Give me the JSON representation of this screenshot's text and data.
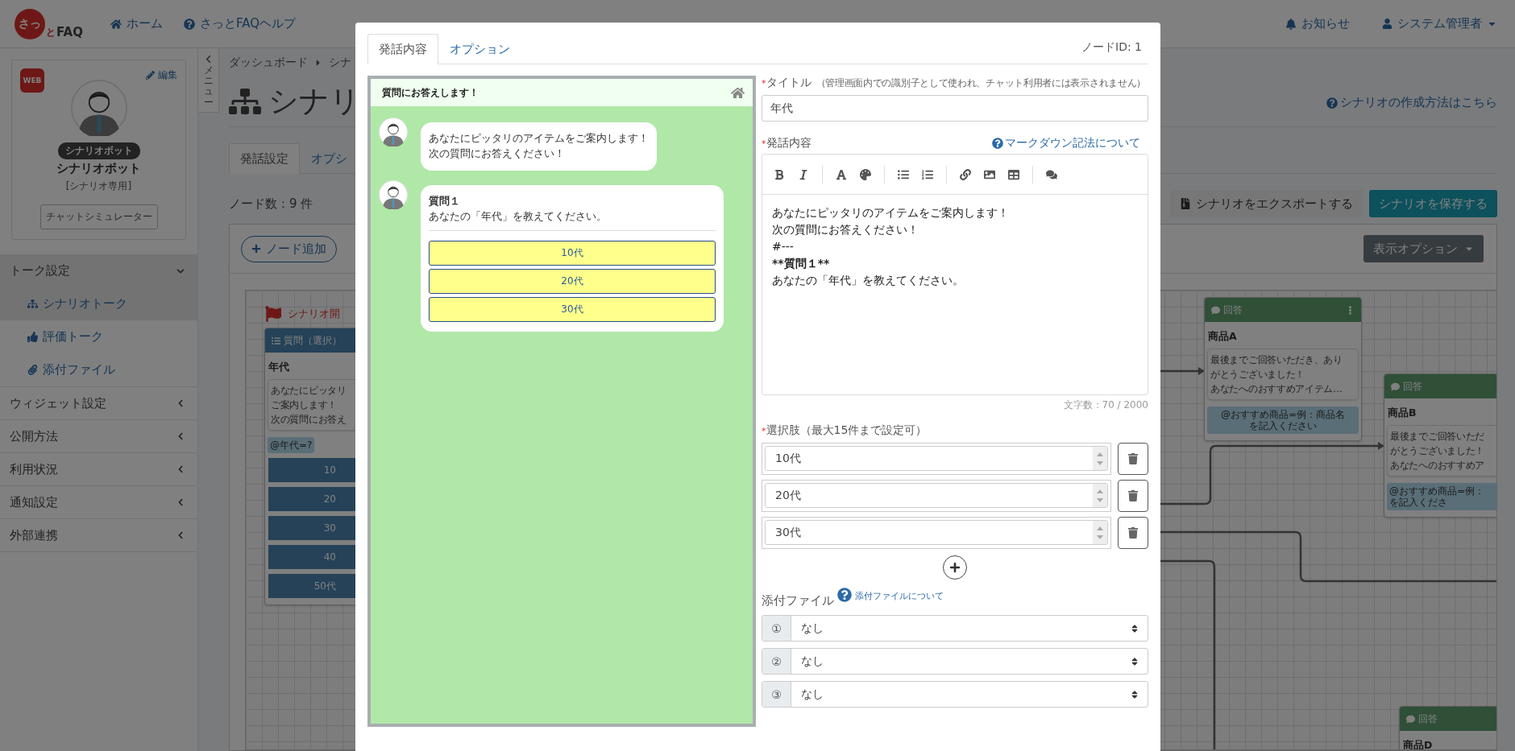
{
  "header": {
    "logo": {
      "mark": "さっ",
      "tail": "と",
      "name": "FAQ"
    },
    "nav": [
      {
        "label": "ホーム",
        "kind": "home"
      },
      {
        "label": "さっとFAQヘルプ",
        "kind": "help"
      }
    ],
    "notifications": "お知らせ",
    "user": "システム管理者"
  },
  "profile": {
    "badge": "WEB",
    "edit": "編集",
    "tag": "シナリオボット",
    "name": "シナリオボット",
    "note": "[シナリオ専用]",
    "simulator_button": "チャットシミュレーター"
  },
  "sidebar": {
    "items": [
      {
        "label": "トーク設定",
        "expanded": true,
        "children": [
          {
            "label": "シナリオトーク",
            "kind": "scenario",
            "selected": true
          },
          {
            "label": "評価トーク",
            "kind": "rating",
            "selected": false
          },
          {
            "label": "添付ファイル",
            "kind": "attachment",
            "selected": false
          }
        ]
      },
      {
        "label": "ウィジェット設定",
        "expanded": false
      },
      {
        "label": "公開方法",
        "expanded": false
      },
      {
        "label": "利用状況",
        "expanded": false
      },
      {
        "label": "通知設定",
        "expanded": false
      },
      {
        "label": "外部連携",
        "expanded": false
      }
    ]
  },
  "menu_toggle": "メニュー",
  "breadcrumb": [
    "ダッシュボード",
    "シナ"
  ],
  "page_title": "シナリ",
  "help_link": "シナリオの作成方法はこちら",
  "tabs": [
    {
      "label": "発話設定",
      "selected": true
    },
    {
      "label": "オプシ",
      "selected": false
    }
  ],
  "node_count": "ノード数：9 件",
  "export_button": "シナリオをエクスポートする",
  "save_button": "シナリオを保存する",
  "canvas": {
    "add_node_button": "ノード追加",
    "view_options_button": "表示オプション",
    "start_label": "シナリオ開",
    "nodes": [
      {
        "kind": "question",
        "header": "質問（選択）",
        "title": "年代",
        "text_lines": [
          "あなたにピッタリ",
          "ご案内します！",
          "次の質問にお答え"
        ],
        "variable_lines": [
          "@年代=?"
        ],
        "choices": [
          "10",
          "20",
          "30",
          "40",
          "50代"
        ]
      },
      {
        "kind": "answer",
        "header": "回答",
        "title": "商品A",
        "text_lines": [
          "最後までご回答いただき、あり",
          "がとうございました！",
          "あなたへのおすすめアイテム…"
        ],
        "variable_lines": [
          "@おすすめ商品=例：商品名",
          "を記入ください"
        ]
      },
      {
        "kind": "answer",
        "header": "回答",
        "title": "商品B",
        "text_lines": [
          "最後までご回答いただ",
          "がとうございました！",
          "あなたへのおすすめア"
        ],
        "variable_lines": [
          "@おすすめ商品=例：",
          "を記入くださ"
        ]
      },
      {
        "kind": "answer",
        "header": "回答",
        "title": "商品D"
      }
    ]
  },
  "modal": {
    "tabs": [
      {
        "label": "発話内容",
        "selected": true
      },
      {
        "label": "オプション",
        "selected": false
      }
    ],
    "node_id": "ノードID: 1",
    "preview": {
      "header": "質問にお答えします！",
      "messages": [
        {
          "kind": "text",
          "lines": [
            "あなたにピッタリのアイテムをご案内します！",
            "次の質問にお答えください！"
          ]
        },
        {
          "kind": "question",
          "title": "質問１",
          "text": "あなたの「年代」を教えてください。",
          "choices": [
            "10代",
            "20代",
            "30代"
          ]
        }
      ]
    },
    "form": {
      "title_label": {
        "mark": "*",
        "text": "タイトル",
        "note": "（管理画面内での識別子として使われ、チャット利用者には表示されません）"
      },
      "title_value": "年代",
      "content_label": {
        "mark": "*",
        "text": "発話内容"
      },
      "markdown_link": "マークダウン記法について",
      "editor_lines": [
        {
          "text": "あなたにピッタリのアイテムをご案内します！",
          "bold": false
        },
        {
          "text": "次の質問にお答えください！",
          "bold": false
        },
        {
          "text": "#---",
          "bold": false
        },
        {
          "text": "**質問１**",
          "bold": true
        },
        {
          "text": "あなたの「年代」を教えてください。",
          "bold": false
        }
      ],
      "char_count": "文字数：70 / 2000",
      "choices_label": {
        "mark": "*",
        "text": "選択肢（最大15件まで設定可）"
      },
      "choices": [
        "10代",
        "20代",
        "30代"
      ],
      "attach_label": "添付ファイル",
      "attach_link": "添付ファイルについて",
      "attachments": [
        {
          "index": "①",
          "value": "なし"
        },
        {
          "index": "②",
          "value": "なし"
        },
        {
          "index": "③",
          "value": "なし"
        }
      ]
    }
  }
}
